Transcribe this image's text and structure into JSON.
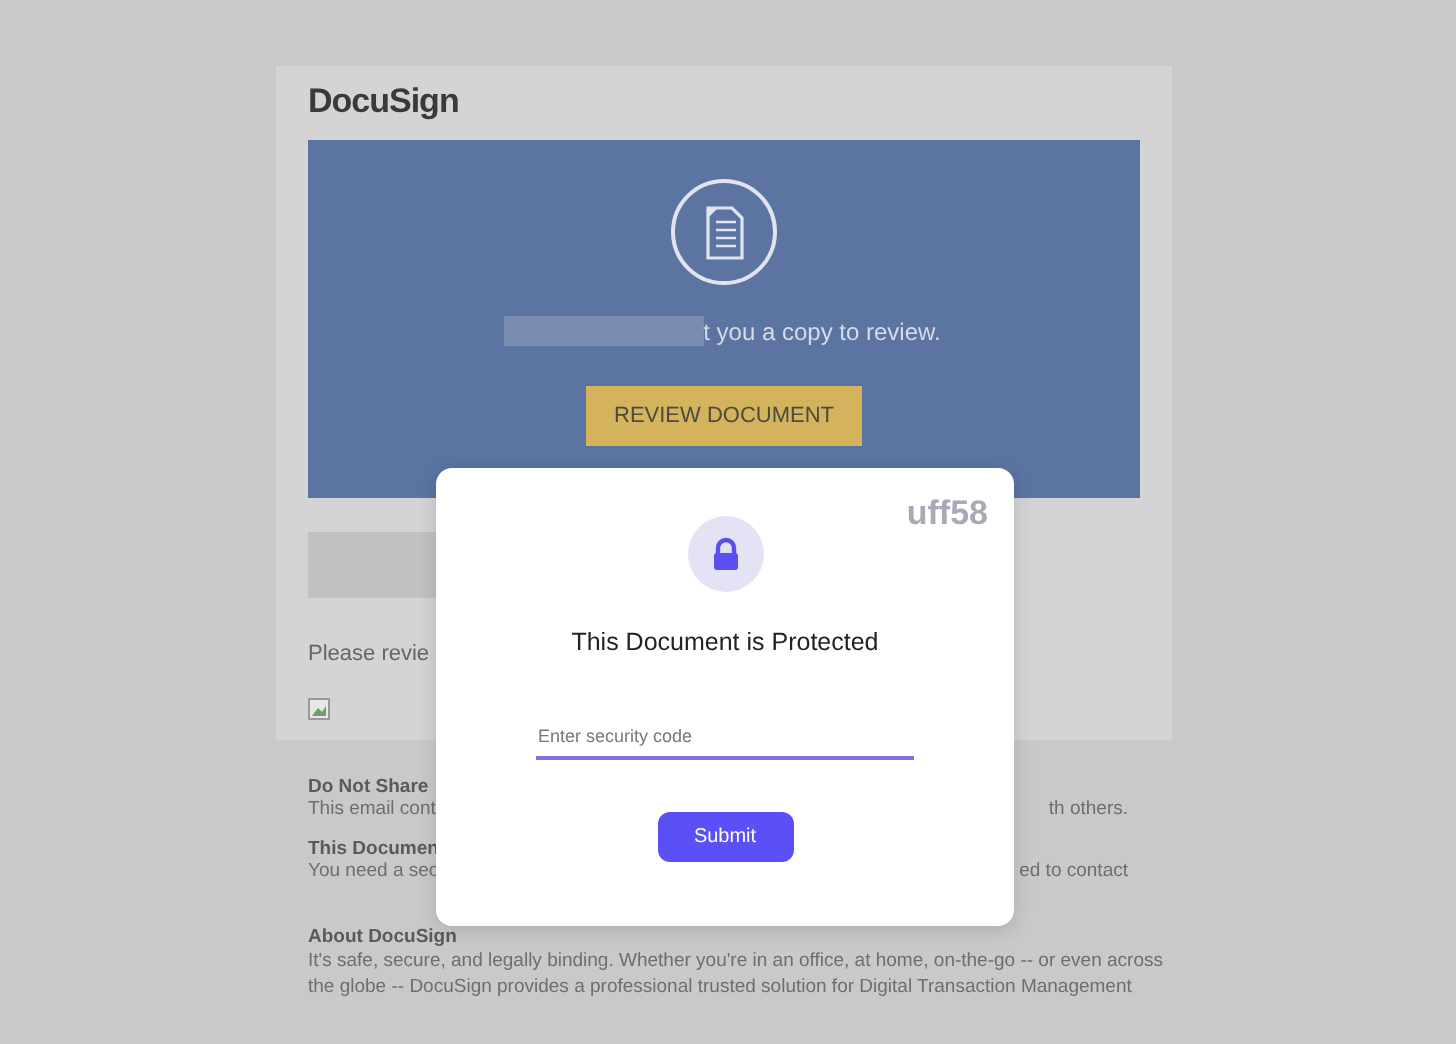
{
  "email": {
    "logo": "DocuSign",
    "banner_message": "t you a copy to review.",
    "review_button": "REVIEW DOCUMENT",
    "body_text": "Please revie",
    "notices": [
      {
        "heading": "Do Not Share",
        "text_start": "This email cont",
        "text_end": "th others."
      },
      {
        "heading": "This Documen",
        "text_start": "You need a sec",
        "text_end": "ed to contact"
      }
    ],
    "about": {
      "heading": "About DocuSign",
      "text": "It's safe, secure, and legally binding. Whether you're in an office, at home, on-the-go -- or even across the globe -- DocuSign provides a professional trusted solution for Digital Transaction Management"
    }
  },
  "modal": {
    "code": "uff58",
    "title": "This Document is Protected",
    "field": {
      "placeholder": "Enter security code"
    },
    "submit": "Submit"
  }
}
